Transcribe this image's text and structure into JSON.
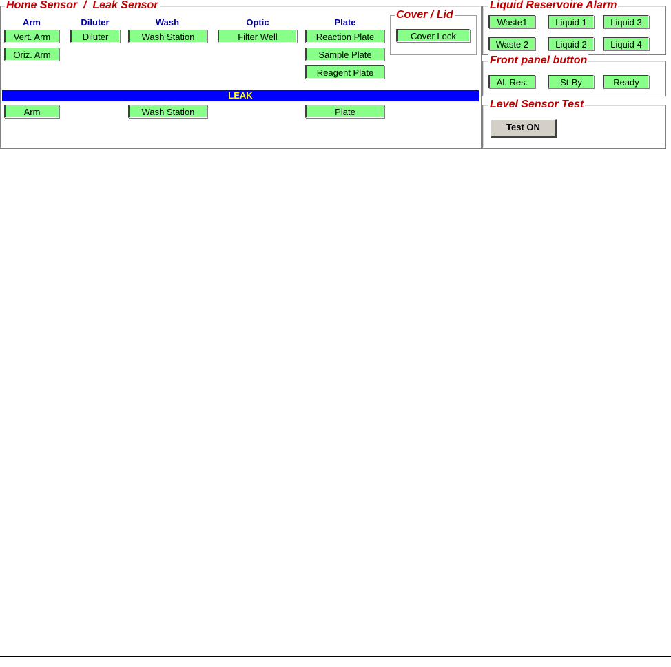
{
  "home_leak": {
    "title": "Home Sensor  /  Leak Sensor",
    "columns": {
      "arm": "Arm",
      "diluter": "Diluter",
      "wash": "Wash",
      "optic": "Optic",
      "plate": "Plate"
    },
    "home": {
      "vert_arm": "Vert. Arm",
      "oriz_arm": "Oriz. Arm",
      "diluter": "Diluter",
      "wash_station": "Wash Station",
      "filter_well": "Filter Well",
      "reaction_plate": "Reaction Plate",
      "sample_plate": "Sample Plate",
      "reagent_plate": "Reagent Plate"
    },
    "leak_label": "LEAK",
    "leak": {
      "arm": "Arm",
      "wash_station": "Wash Station",
      "plate": "Plate"
    }
  },
  "cover": {
    "title": "Cover / Lid",
    "cover_lock": "Cover Lock"
  },
  "liquid": {
    "title": "Liquid Reservoire Alarm",
    "items": [
      "Waste1",
      "Liquid 1",
      "Liquid 3",
      "Waste 2",
      "Liquid 2",
      "Liquid 4"
    ]
  },
  "front_panel": {
    "title": "Front panel button",
    "items": [
      "Al. Res.",
      "St-By",
      "Ready"
    ]
  },
  "level_test": {
    "title": "Level Sensor Test",
    "button": "Test ON"
  },
  "colors": {
    "indicator_on": "#88ff88",
    "legend_text": "#c00000",
    "column_head": "#0000a0",
    "leak_bar": "#0000ff",
    "leak_text": "#ffff00"
  }
}
